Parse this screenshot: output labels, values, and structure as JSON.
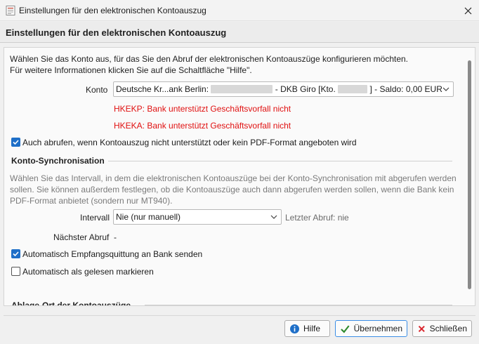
{
  "window": {
    "title": "Einstellungen für den elektronischen Kontoauszug"
  },
  "header": {
    "title": "Einstellungen für den elektronischen Kontoauszug"
  },
  "intro": {
    "line1": "Wählen Sie das Konto aus, für das Sie den Abruf der elektronischen Kontoauszüge konfigurieren möchten.",
    "line2": "Für weitere Informationen klicken Sie auf die Schaltfläche \"Hilfe\"."
  },
  "account": {
    "label": "Konto",
    "value_prefix": "Deutsche Kr...ank Berlin:",
    "value_middle": "- DKB Giro [Kto.",
    "value_suffix": "] - Saldo: 0,00 EUR"
  },
  "errors": [
    "HKEKP: Bank unterstützt Geschäftsvorfall nicht",
    "HKEKA: Bank unterstützt Geschäftsvorfall nicht"
  ],
  "options": {
    "fetch_unsupported": {
      "label": "Auch abrufen, wenn Kontoauszug nicht unterstützt oder kein PDF-Format angeboten wird",
      "checked": true
    }
  },
  "sync": {
    "title": "Konto-Synchronisation",
    "desc1": "Wählen Sie das Intervall, in dem die elektronischen Kontoauszüge bei der Konto-Synchronisation mit abgerufen werden",
    "desc2": "sollen. Sie können außerdem festlegen, ob die Kontoauszüge auch dann abgerufen werden sollen, wenn die Bank kein",
    "desc3": "PDF-Format anbietet (sondern nur MT940).",
    "interval_label": "Intervall",
    "interval_value": "Nie (nur manuell)",
    "last_fetch": "Letzter Abruf: nie",
    "next_label": "Nächster Abruf",
    "next_value": "-",
    "auto_receipt": {
      "label": "Automatisch Empfangsquittung an Bank senden",
      "checked": true
    },
    "auto_read": {
      "label": "Automatisch als gelesen markieren",
      "checked": false
    }
  },
  "storage": {
    "title": "Ablage-Ort der Kontoauszüge"
  },
  "buttons": {
    "help": "Hilfe",
    "apply": "Übernehmen",
    "close": "Schließen"
  },
  "colors": {
    "accent": "#1e6fc8",
    "error": "#e01010",
    "check_green": "#2e8b2e",
    "close_red": "#d9272e"
  }
}
